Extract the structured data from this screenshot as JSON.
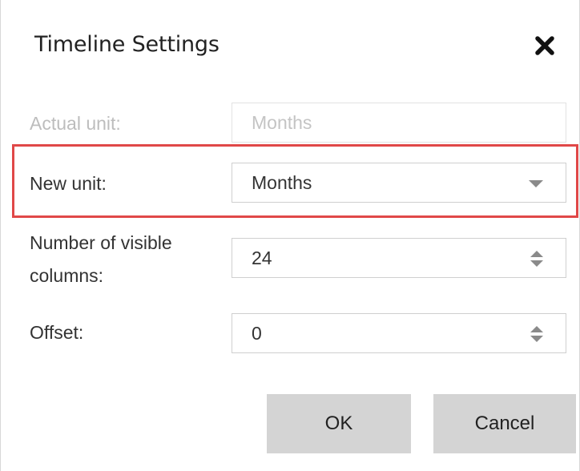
{
  "dialog": {
    "title": "Timeline Settings",
    "close_icon": "close-icon"
  },
  "form": {
    "actual_unit": {
      "label": "Actual unit:",
      "value": "Months",
      "disabled": true
    },
    "new_unit": {
      "label": "New unit:",
      "value": "Months",
      "control": "dropdown",
      "highlighted": true
    },
    "visible_columns": {
      "label_line1": "Number of visible",
      "label_line2": "columns:",
      "value": "24",
      "control": "spinner"
    },
    "offset": {
      "label": "Offset:",
      "value": "0",
      "control": "spinner"
    }
  },
  "buttons": {
    "ok_label": "OK",
    "cancel_label": "Cancel"
  },
  "colors": {
    "highlight_border": "#e04848",
    "button_bg": "#d4d4d4",
    "disabled_text": "#bdbdbd"
  }
}
